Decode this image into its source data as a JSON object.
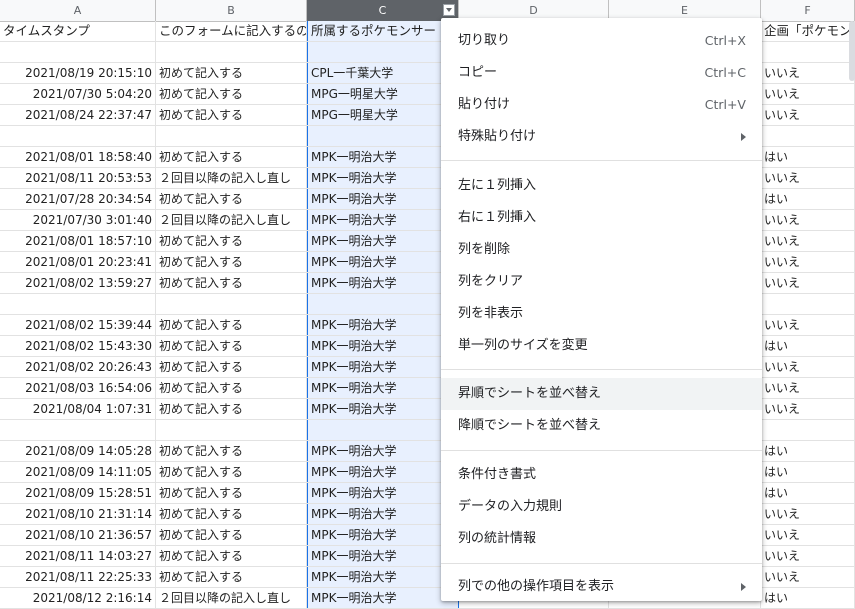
{
  "columns": [
    {
      "letter": "A",
      "label": "A"
    },
    {
      "letter": "B",
      "label": "B"
    },
    {
      "letter": "C",
      "label": "C"
    },
    {
      "letter": "D",
      "label": "D"
    },
    {
      "letter": "E",
      "label": "E"
    },
    {
      "letter": "F",
      "label": "F"
    }
  ],
  "header_row": {
    "a": "タイムスタンプ",
    "b": "このフォームに記入するの",
    "c": "所属するポケモンサー",
    "f": "企画「ポケモン"
  },
  "rows": [
    {
      "a": "",
      "b": "",
      "c": "",
      "f": ""
    },
    {
      "a": "2021/08/19 20:15:10",
      "b": "初めて記入する",
      "c": "CPL一千葉大学",
      "f": "いいえ"
    },
    {
      "a": "2021/07/30 5:04:20",
      "b": "初めて記入する",
      "c": "MPG一明星大学",
      "f": "いいえ"
    },
    {
      "a": "2021/08/24 22:37:47",
      "b": "初めて記入する",
      "c": "MPG一明星大学",
      "f": "いいえ"
    },
    {
      "a": "",
      "b": "",
      "c": "",
      "f": ""
    },
    {
      "a": "2021/08/01 18:58:40",
      "b": "初めて記入する",
      "c": "MPK一明治大学",
      "f": "はい"
    },
    {
      "a": "2021/08/11 20:53:53",
      "b": "２回目以降の記入し直し",
      "c": "MPK一明治大学",
      "f": "いいえ"
    },
    {
      "a": "2021/07/28 20:34:54",
      "b": "初めて記入する",
      "c": "MPK一明治大学",
      "f": "はい"
    },
    {
      "a": "2021/07/30 3:01:40",
      "b": "２回目以降の記入し直し",
      "c": "MPK一明治大学",
      "f": "いいえ"
    },
    {
      "a": "2021/08/01 18:57:10",
      "b": "初めて記入する",
      "c": "MPK一明治大学",
      "f": "いいえ"
    },
    {
      "a": "2021/08/01 20:23:41",
      "b": "初めて記入する",
      "c": "MPK一明治大学",
      "f": "いいえ"
    },
    {
      "a": "2021/08/02 13:59:27",
      "b": "初めて記入する",
      "c": "MPK一明治大学",
      "f": "いいえ"
    },
    {
      "a": "",
      "b": "",
      "c": "",
      "f": ""
    },
    {
      "a": "2021/08/02 15:39:44",
      "b": "初めて記入する",
      "c": "MPK一明治大学",
      "f": "いいえ"
    },
    {
      "a": "2021/08/02 15:43:30",
      "b": "初めて記入する",
      "c": "MPK一明治大学",
      "f": "はい"
    },
    {
      "a": "2021/08/02 20:26:43",
      "b": "初めて記入する",
      "c": "MPK一明治大学",
      "f": "いいえ"
    },
    {
      "a": "2021/08/03 16:54:06",
      "b": "初めて記入する",
      "c": "MPK一明治大学",
      "f": "いいえ"
    },
    {
      "a": "2021/08/04 1:07:31",
      "b": "初めて記入する",
      "c": "MPK一明治大学",
      "f": "いいえ"
    },
    {
      "a": "",
      "b": "",
      "c": "",
      "f": ""
    },
    {
      "a": "2021/08/09 14:05:28",
      "b": "初めて記入する",
      "c": "MPK一明治大学",
      "f": "はい"
    },
    {
      "a": "2021/08/09 14:11:05",
      "b": "初めて記入する",
      "c": "MPK一明治大学",
      "f": "はい"
    },
    {
      "a": "2021/08/09 15:28:51",
      "b": "初めて記入する",
      "c": "MPK一明治大学",
      "f": "はい"
    },
    {
      "a": "2021/08/10 21:31:14",
      "b": "初めて記入する",
      "c": "MPK一明治大学",
      "f": "いいえ"
    },
    {
      "a": "2021/08/10 21:36:57",
      "b": "初めて記入する",
      "c": "MPK一明治大学",
      "f": "いいえ"
    },
    {
      "a": "2021/08/11 14:03:27",
      "b": "初めて記入する",
      "c": "MPK一明治大学",
      "f": "いいえ"
    },
    {
      "a": "2021/08/11 22:25:33",
      "b": "初めて記入する",
      "c": "MPK一明治大学",
      "f": "いいえ"
    },
    {
      "a": "2021/08/12 2:16:14",
      "b": "２回目以降の記入し直し",
      "c": "MPK一明治大学",
      "f": "はい"
    }
  ],
  "context_menu": {
    "cut": {
      "label": "切り取り",
      "shortcut": "Ctrl+X"
    },
    "copy": {
      "label": "コピー",
      "shortcut": "Ctrl+C"
    },
    "paste": {
      "label": "貼り付け",
      "shortcut": "Ctrl+V"
    },
    "paste_special": {
      "label": "特殊貼り付け"
    },
    "insert_left": {
      "label": "左に１列挿入"
    },
    "insert_right": {
      "label": "右に１列挿入"
    },
    "delete_column": {
      "label": "列を削除"
    },
    "clear_column": {
      "label": "列をクリア"
    },
    "hide_column": {
      "label": "列を非表示"
    },
    "resize_column": {
      "label": "単一列のサイズを変更"
    },
    "sort_asc": {
      "label": "昇順でシートを並べ替え"
    },
    "sort_desc": {
      "label": "降順でシートを並べ替え"
    },
    "conditional_format": {
      "label": "条件付き書式"
    },
    "data_validation": {
      "label": "データの入力規則"
    },
    "column_stats": {
      "label": "列の統計情報"
    },
    "more_actions": {
      "label": "列での他の操作項目を表示"
    }
  },
  "colors": {
    "selected_column_bg": "#e8f0fe",
    "selection_border": "#1a73e8",
    "hover": "#f1f3f4"
  }
}
